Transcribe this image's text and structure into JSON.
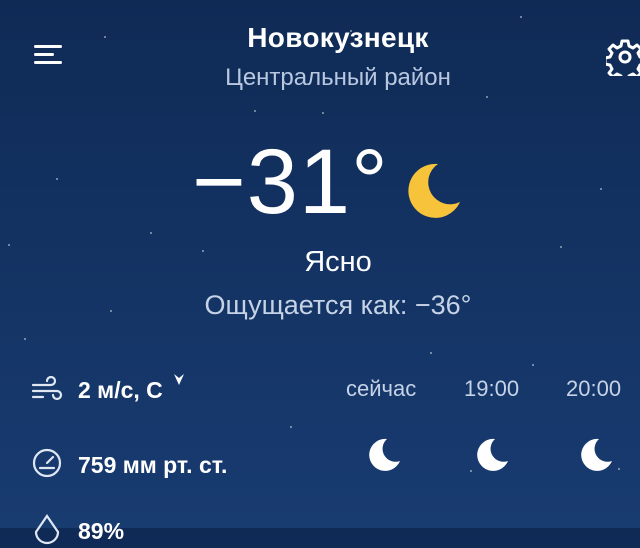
{
  "header": {
    "city": "Новокузнецк",
    "district": "Центральный район",
    "menu_icon": "menu-icon",
    "settings_icon": "gear-icon"
  },
  "current": {
    "temperature": "−31°",
    "condition": "Ясно",
    "feels_like": "Ощущается как: −36°",
    "icon": "moon-icon"
  },
  "details": {
    "wind": "2 м/с, С",
    "wind_direction_icon": "arrow-down-icon",
    "pressure": "759 мм рт. ст.",
    "humidity_partial": "89%"
  },
  "hourly": [
    {
      "time": "сейчас",
      "icon": "moon-icon"
    },
    {
      "time": "19:00",
      "icon": "moon-icon"
    },
    {
      "time": "20:00",
      "icon": "moon-icon"
    }
  ],
  "colors": {
    "background_top": "#0f2a55",
    "background_bottom": "#183b70",
    "moon": "#f6c33a",
    "secondary_text": "#c6d2e6"
  }
}
